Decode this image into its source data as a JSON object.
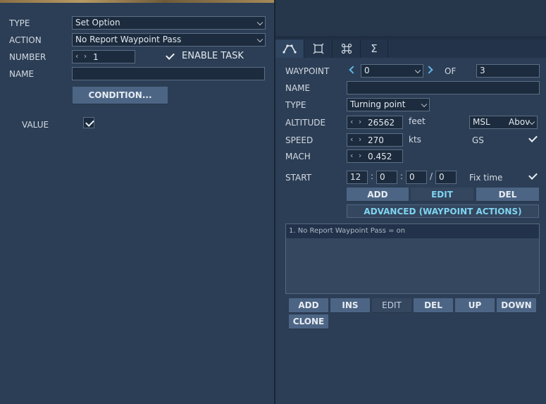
{
  "left": {
    "type_label": "TYPE",
    "type_value": "Set Option",
    "action_label": "ACTION",
    "action_value": "No Report Waypoint Pass",
    "number_label": "NUMBER",
    "number_value": "1",
    "enable_task_label": "ENABLE TASK",
    "enable_task_checked": true,
    "name_label": "NAME",
    "name_value": "",
    "condition_button": "CONDITION...",
    "value_label": "VALUE",
    "value_checked": true
  },
  "tabs": [
    {
      "icon": "route-icon",
      "active": true
    },
    {
      "icon": "target-icon",
      "active": false
    },
    {
      "icon": "command-icon",
      "active": false
    },
    {
      "icon": "sigma-icon",
      "active": false
    }
  ],
  "right": {
    "waypoint_label": "WAYPOINT",
    "waypoint_value": "0",
    "of_label": "OF",
    "of_value": "3",
    "name_label": "NAME",
    "name_value": "",
    "type_label": "TYPE",
    "type_value": "Turning point",
    "altitude_label": "ALTITUDE",
    "altitude_value": "26562",
    "altitude_unit": "feet",
    "altitude_ref": "MSL",
    "altitude_ref_extra": "Abov",
    "speed_label": "SPEED",
    "speed_value": "270",
    "speed_unit": "kts",
    "gs_label": "GS",
    "gs_checked": true,
    "mach_label": "MACH",
    "mach_value": "0.452",
    "start_label": "START",
    "start_h": "12",
    "start_m": "0",
    "start_s": "0",
    "start_d": "0",
    "fix_time_label": "Fix time",
    "fix_time_checked": true,
    "btn_add": "ADD",
    "btn_edit": "EDIT",
    "btn_del": "DEL",
    "btn_advanced": "ADVANCED (WAYPOINT ACTIONS)",
    "actions": [
      "1. No Report Waypoint Pass = on"
    ],
    "list_buttons": {
      "add": "ADD",
      "ins": "INS",
      "edit": "EDIT",
      "del": "DEL",
      "up": "UP",
      "down": "DOWN",
      "clone": "CLONE"
    }
  }
}
